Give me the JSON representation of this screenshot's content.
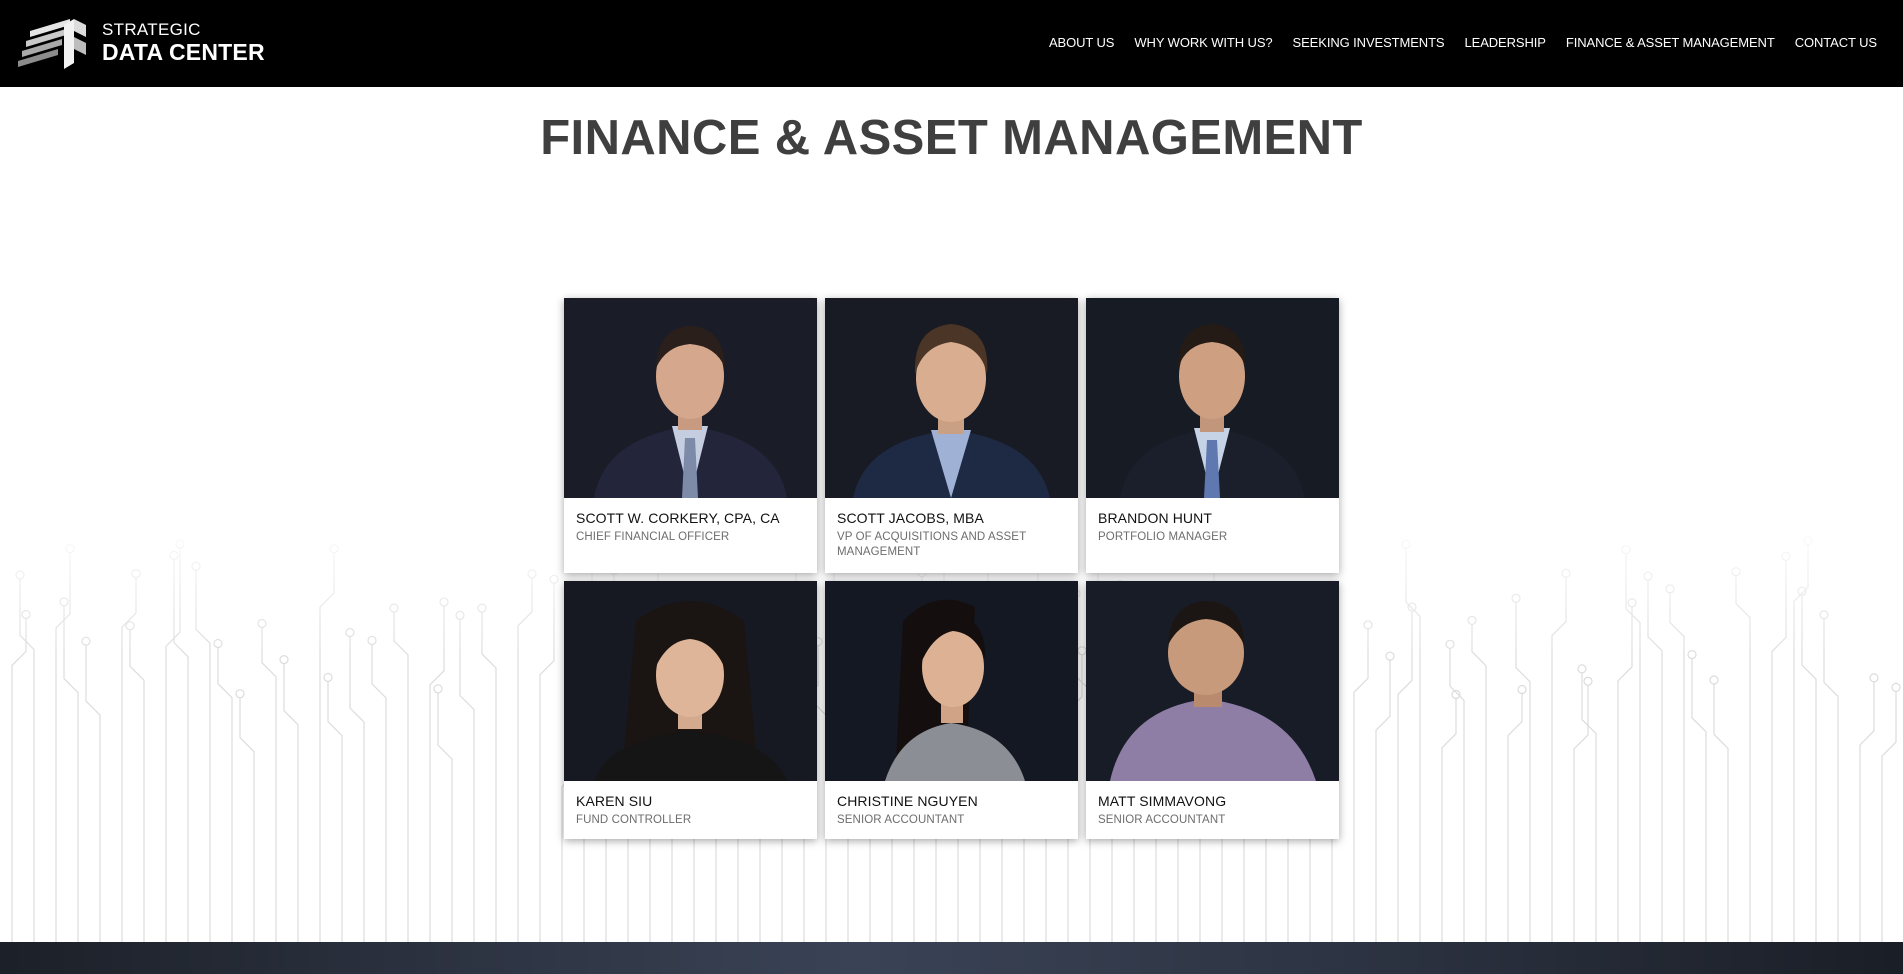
{
  "header": {
    "logo": {
      "line1": "STRATEGIC",
      "line2": "DATA CENTER"
    },
    "nav": [
      {
        "label": "ABOUT US"
      },
      {
        "label": "WHY WORK WITH US?"
      },
      {
        "label": "SEEKING INVESTMENTS"
      },
      {
        "label": "LEADERSHIP"
      },
      {
        "label": "FINANCE & ASSET MANAGEMENT"
      },
      {
        "label": "CONTACT US"
      }
    ]
  },
  "main": {
    "title": "FINANCE & ASSET MANAGEMENT",
    "team": [
      {
        "name": "SCOTT W. CORKERY, CPA, CA",
        "role": "CHIEF FINANCIAL OFFICER"
      },
      {
        "name": "SCOTT JACOBS, MBA",
        "role": "VP OF ACQUISITIONS AND ASSET MANAGEMENT"
      },
      {
        "name": "BRANDON HUNT",
        "role": "PORTFOLIO MANAGER"
      },
      {
        "name": "KAREN SIU",
        "role": "FUND CONTROLLER"
      },
      {
        "name": "CHRISTINE NGUYEN",
        "role": "SENIOR ACCOUNTANT"
      },
      {
        "name": "MATT SIMMAVONG",
        "role": "SENIOR ACCOUNTANT"
      }
    ]
  },
  "colors": {
    "header_bg": "#000000",
    "title_text": "#3f3f3f",
    "card_bg": "#ffffff",
    "photo_bg": "#16181f"
  }
}
